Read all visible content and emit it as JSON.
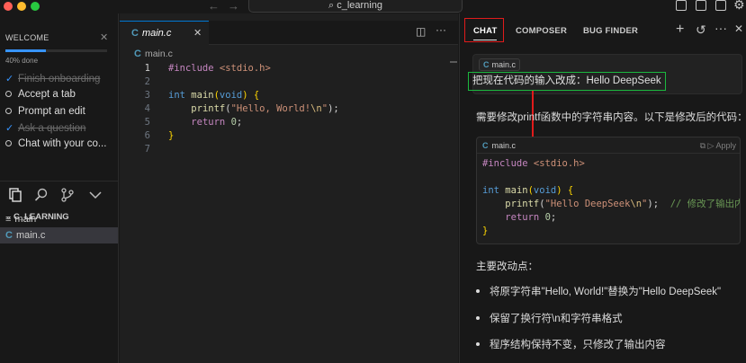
{
  "titlebar": {
    "back_icon": "arrow-left-icon",
    "forward_icon": "arrow-right-icon",
    "search_text": "c_learning"
  },
  "welcome": {
    "title": "WELCOME",
    "progress_label": "40% done",
    "progress": 0.4,
    "items": [
      {
        "label": "Finish onboarding",
        "done": true
      },
      {
        "label": "Accept a tab",
        "done": false
      },
      {
        "label": "Prompt an edit",
        "done": false
      },
      {
        "label": "Ask a question",
        "done": true
      },
      {
        "label": "Chat with your co...",
        "done": false
      }
    ]
  },
  "explorer": {
    "title": "C_LEARNING",
    "items": [
      {
        "icon": "≡",
        "label": "main",
        "selected": false
      },
      {
        "icon": "C",
        "label": "main.c",
        "selected": true
      }
    ]
  },
  "editor": {
    "tab_label": "main.c",
    "breadcrumb": "main.c",
    "line_numbers": [
      "1",
      "2",
      "3",
      "4",
      "5",
      "6",
      "7"
    ]
  },
  "chat": {
    "tabs": [
      "CHAT",
      "COMPOSER",
      "BUG FINDER"
    ],
    "user_file_chip": "main.c",
    "user_message": "把现在代码的输入改成：Hello DeepSeek",
    "ai_intro": "需要修改printf函数中的字符串内容。以下是修改后的代码：",
    "code_file": "main.c",
    "apply_label": "Apply",
    "summary_title": "主要改动点：",
    "bullets": [
      "将原字符串\"Hello, World!\"替换为\"Hello DeepSeek\"",
      "保留了换行符\\n和字符串格式",
      "程序结构保持不变，只修改了输出内容"
    ]
  },
  "colors": {
    "accent": "#0078d4",
    "highlight_red": "#e01b1b",
    "highlight_green": "#1bb83e"
  }
}
